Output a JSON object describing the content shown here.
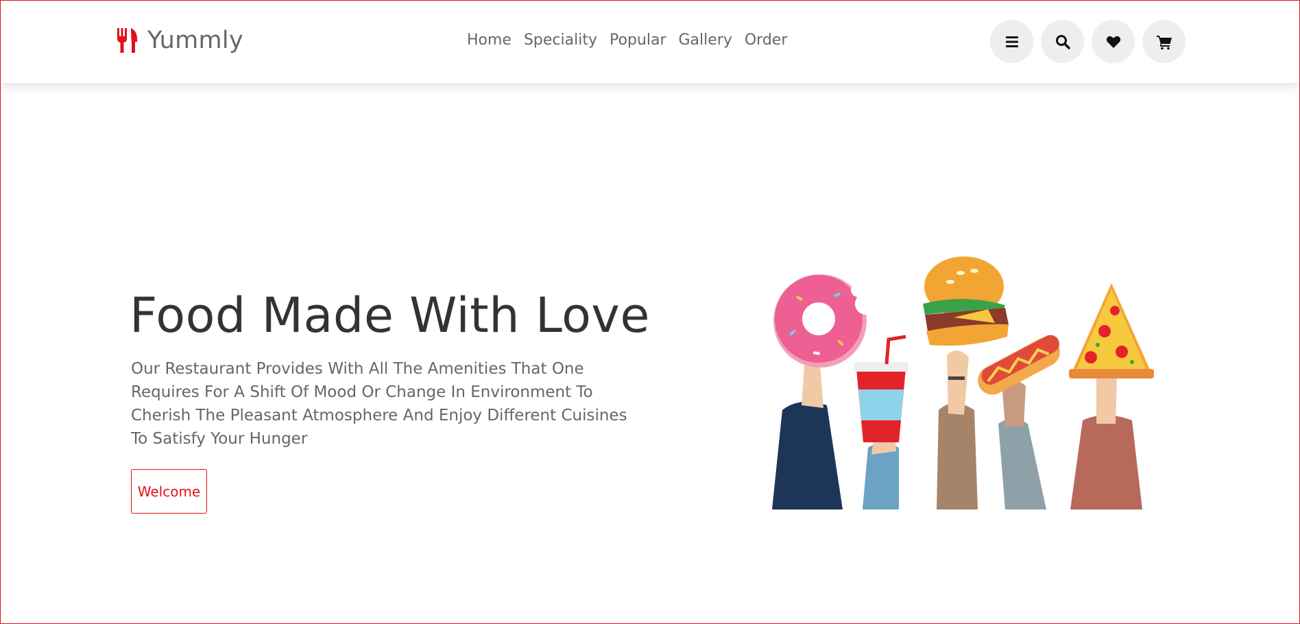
{
  "header": {
    "logo_text": "Yummly",
    "nav": [
      "Home",
      "Speciality",
      "Popular",
      "Gallery",
      "Order"
    ],
    "icons": [
      "menu-bars-icon",
      "search-icon",
      "heart-icon",
      "cart-icon"
    ]
  },
  "hero": {
    "title": "Food Made With Love",
    "description": "Our Restaurant Provides With All The Amenities That One Requires For A Shift Of Mood Or Change In Environment To Cherish The Pleasant Atmosphere And Enjoy Different Cuisines To Satisfy Your Hunger",
    "button_label": "Welcome",
    "illustration": "hands-holding-donut-soda-burger-hotdog-pizza"
  },
  "colors": {
    "accent": "#e0111b",
    "text_dark": "#333333",
    "text_muted": "#666666",
    "icon_bg": "#eeeeee"
  }
}
